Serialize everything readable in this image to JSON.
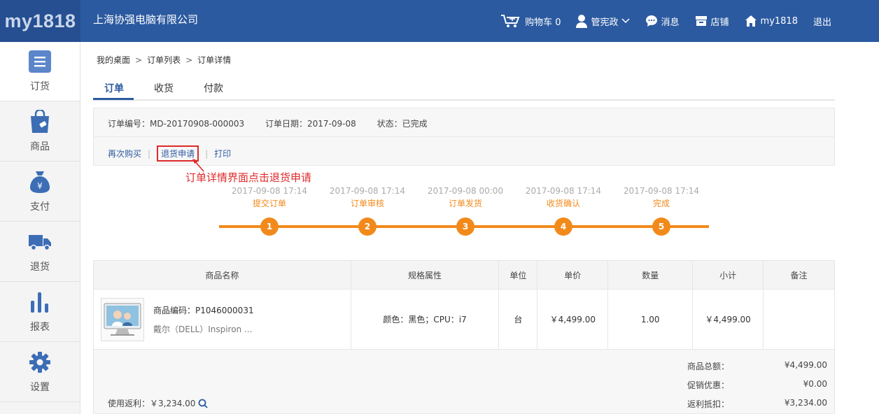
{
  "header": {
    "logo": "my1818",
    "company": "上海协强电脑有限公司",
    "nav": {
      "cart": "购物车 0",
      "user": "管宪政",
      "messages": "消息",
      "store": "店铺",
      "home": "my1818",
      "logout": "退出"
    }
  },
  "sidebar": {
    "items": [
      {
        "label": "订货",
        "icon": "menu-icon"
      },
      {
        "label": "商品",
        "icon": "shopping-bag-icon"
      },
      {
        "label": "支付",
        "icon": "money-bag-icon"
      },
      {
        "label": "退货",
        "icon": "truck-icon"
      },
      {
        "label": "报表",
        "icon": "bar-chart-icon"
      },
      {
        "label": "设置",
        "icon": "gear-icon"
      }
    ]
  },
  "breadcrumb": {
    "items": [
      "我的桌面",
      "订单列表",
      "订单详情"
    ],
    "separator": ">"
  },
  "tabs": [
    "订单",
    "收货",
    "付款"
  ],
  "order": {
    "number": "订单编号：MD-20170908-000003",
    "date": "订单日期：2017-09-08",
    "status": "状态：已完成"
  },
  "actions": {
    "rebuy": "再次购买",
    "return": "退货申请",
    "print": "打印"
  },
  "annotation": "订单详情界面点击退货申请",
  "timeline": [
    {
      "date": "2017-09-08 17:14",
      "label": "提交订单",
      "num": "1"
    },
    {
      "date": "2017-09-08 17:14",
      "label": "订单审核",
      "num": "2"
    },
    {
      "date": "2017-09-08 00:00",
      "label": "订单发货",
      "num": "3"
    },
    {
      "date": "2017-09-08 17:14",
      "label": "收货确认",
      "num": "4"
    },
    {
      "date": "2017-09-08 17:14",
      "label": "完成",
      "num": "5"
    }
  ],
  "table": {
    "headers": [
      "商品名称",
      "规格属性",
      "单位",
      "单价",
      "数量",
      "小计",
      "备注"
    ],
    "rows": [
      {
        "code": "商品编码：P1046000031",
        "name": "戴尔（DELL）Inspiron ...",
        "spec": "颜色：黑色；CPU：i7",
        "unit": "台",
        "price": "￥4,499.00",
        "qty": "1.00",
        "subtotal": "￥4,499.00",
        "note": ""
      }
    ]
  },
  "summary": {
    "rebate": "使用返利：￥3,234.00",
    "total_label": "商品总额：",
    "total_value": "¥4,499.00",
    "promo_label": "促销优惠：",
    "promo_value": "¥0.00",
    "rebate_label": "返利抵扣：",
    "rebate_value": "¥3,234.00"
  },
  "colors": {
    "brand": "#2c5aa0",
    "accent": "#f28a1b",
    "highlight": "#e02a2a"
  }
}
